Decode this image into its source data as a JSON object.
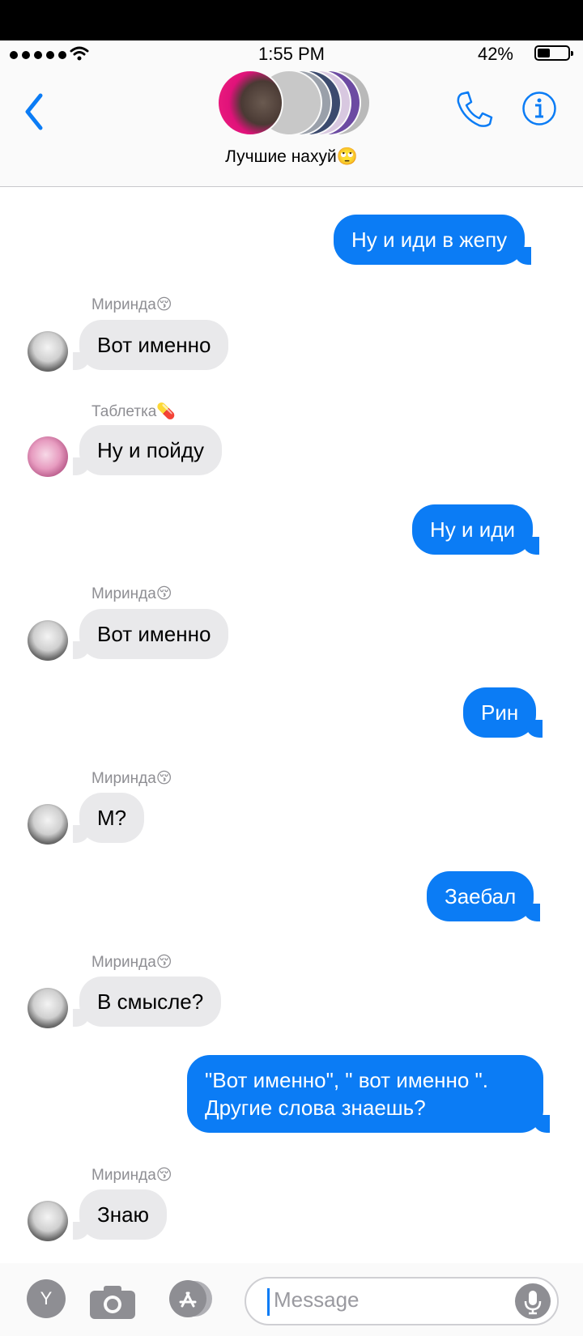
{
  "status": {
    "time": "1:55 PM",
    "battery_pct": "42%",
    "battery_level": 0.42
  },
  "header": {
    "group_title": "Лучшие нахуй🙄",
    "icons": [
      "back-chevron-icon",
      "phone-icon",
      "info-icon"
    ]
  },
  "messages": [
    {
      "direction": "out",
      "text": "Ну и иди в жепу"
    },
    {
      "direction": "in",
      "sender": "Миринда😚",
      "text": "Вот именно"
    },
    {
      "direction": "in",
      "sender": "Таблетка💊",
      "text": "Ну и пойду"
    },
    {
      "direction": "out",
      "text": "Ну и иди"
    },
    {
      "direction": "in",
      "sender": "Миринда😚",
      "text": "Вот именно"
    },
    {
      "direction": "out",
      "text": "Рин"
    },
    {
      "direction": "in",
      "sender": "Миринда😚",
      "text": "М?"
    },
    {
      "direction": "out",
      "text": "Заебал"
    },
    {
      "direction": "in",
      "sender": "Миринда😚",
      "text": "В смысле?"
    },
    {
      "direction": "out",
      "text": "\"Вот именно\", \" вот именно \". Другие слова знаешь?"
    },
    {
      "direction": "in",
      "sender": "Миринда😚",
      "text": "Знаю"
    }
  ],
  "composer": {
    "placeholder": "Message",
    "y_label": "Y"
  },
  "colors": {
    "outgoing": "#0b7cf5",
    "incoming": "#e9e9eb",
    "accent": "#0b7cf5"
  }
}
